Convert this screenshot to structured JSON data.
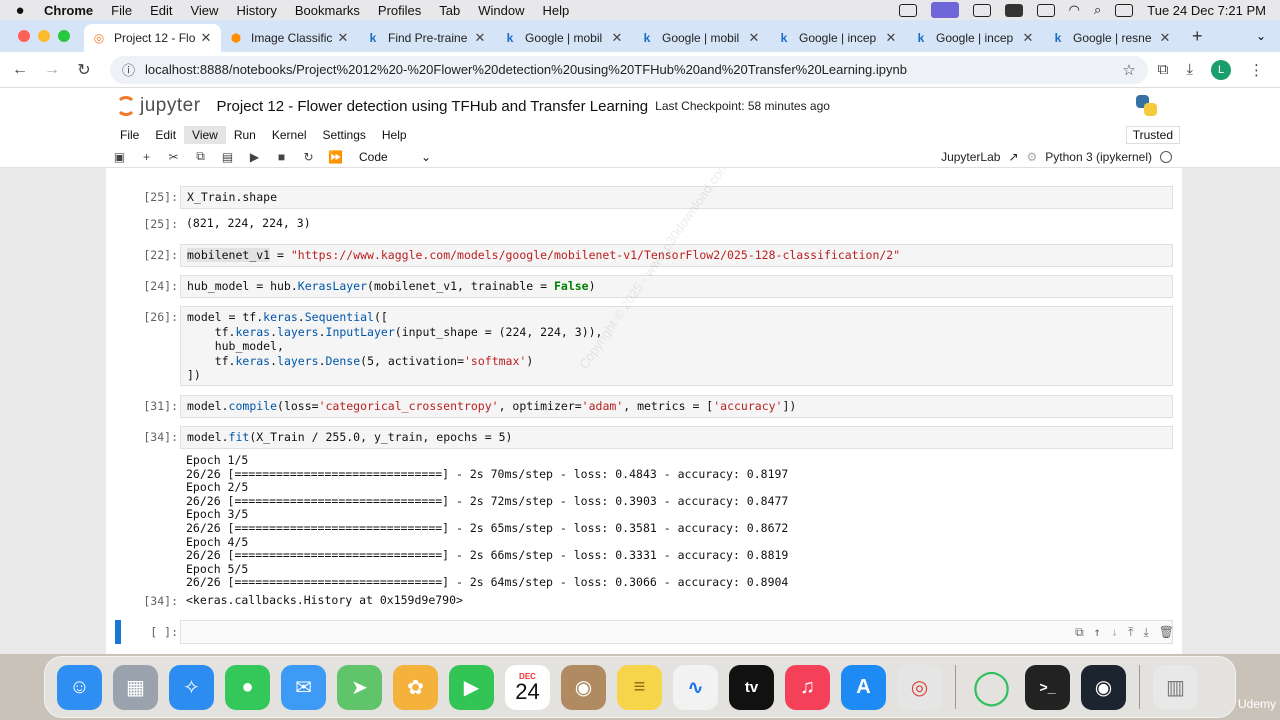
{
  "menubar": {
    "app": "Chrome",
    "items": [
      "File",
      "Edit",
      "View",
      "History",
      "Bookmarks",
      "Profiles",
      "Tab",
      "Window",
      "Help"
    ],
    "clock": "Tue 24 Dec  7:21 PM"
  },
  "tabs": [
    {
      "title": "Project 12 - Flo",
      "favicon": "jupyter-icon",
      "active": true
    },
    {
      "title": "Image Classific",
      "favicon": "tfhub-icon",
      "active": false
    },
    {
      "title": "Find Pre-traine",
      "favicon": "kaggle-icon",
      "active": false
    },
    {
      "title": "Google | mobil",
      "favicon": "kaggle-icon",
      "active": false
    },
    {
      "title": "Google | mobil",
      "favicon": "kaggle-icon",
      "active": false
    },
    {
      "title": "Google | incep",
      "favicon": "kaggle-icon",
      "active": false
    },
    {
      "title": "Google | incep",
      "favicon": "kaggle-icon",
      "active": false
    },
    {
      "title": "Google | resne",
      "favicon": "kaggle-icon",
      "active": false
    }
  ],
  "address": {
    "url": "localhost:8888/notebooks/Project%2012%20-%20Flower%20detection%20using%20TFHub%20and%20Transfer%20Learning.ipynb",
    "profile_initial": "L"
  },
  "jupyter": {
    "logo_text": "jupyter",
    "notebook_title": "Project 12 - Flower detection using TFHub and Transfer Learning",
    "checkpoint": "Last Checkpoint: 58 minutes ago",
    "menus": [
      "File",
      "Edit",
      "View",
      "Run",
      "Kernel",
      "Settings",
      "Help"
    ],
    "trusted": "Trusted",
    "cell_type": "Code",
    "jupyterlab_link": "JupyterLab",
    "kernel": "Python 3 (ipykernel)"
  },
  "cells": {
    "c1": {
      "prompt": "[25]:",
      "code": "X_Train.shape",
      "out_prompt": "[25]:",
      "output": "(821, 224, 224, 3)"
    },
    "c2": {
      "prompt": "[22]:"
    },
    "c3": {
      "prompt": "[24]:"
    },
    "c4": {
      "prompt": "[26]:"
    },
    "c5": {
      "prompt": "[31]:"
    },
    "c6": {
      "prompt": "[34]:",
      "out_prompt": "[34]:",
      "result": "<keras.callbacks.History at 0x159d9e790>"
    },
    "c7": {
      "prompt": "[ ]:"
    }
  },
  "training_log": [
    "Epoch 1/5",
    "26/26 [==============================] - 2s 70ms/step - loss: 0.4843 - accuracy: 0.8197",
    "Epoch 2/5",
    "26/26 [==============================] - 2s 72ms/step - loss: 0.3903 - accuracy: 0.8477",
    "Epoch 3/5",
    "26/26 [==============================] - 2s 65ms/step - loss: 0.3581 - accuracy: 0.8672",
    "Epoch 4/5",
    "26/26 [==============================] - 2s 66ms/step - loss: 0.3331 - accuracy: 0.8819",
    "Epoch 5/5",
    "26/26 [==============================] - 2s 64ms/step - loss: 0.3066 - accuracy: 0.8904"
  ],
  "dock": {
    "apps": [
      {
        "name": "finder-icon",
        "color": "#2f8ef1",
        "glyph": "☺"
      },
      {
        "name": "launchpad-icon",
        "color": "#9aa3ad",
        "glyph": "▦"
      },
      {
        "name": "safari-icon",
        "color": "#2d8cf0",
        "glyph": "✧"
      },
      {
        "name": "messages-icon",
        "color": "#34c759",
        "glyph": "●"
      },
      {
        "name": "mail-icon",
        "color": "#3d9bf5",
        "glyph": "✉"
      },
      {
        "name": "maps-icon",
        "color": "#5fc46a",
        "glyph": "➤"
      },
      {
        "name": "photos-icon",
        "color": "#f4b13c",
        "glyph": "✿"
      },
      {
        "name": "facetime-icon",
        "color": "#32c454",
        "glyph": "▶"
      },
      {
        "name": "calendar-icon",
        "color": "#ffffff",
        "glyph": ""
      },
      {
        "name": "contacts-icon",
        "color": "#b08b62",
        "glyph": "◉"
      },
      {
        "name": "notes-icon",
        "color": "#f7d54a",
        "glyph": "≡"
      },
      {
        "name": "freeform-icon",
        "color": "#f2f2f2",
        "glyph": "∿"
      },
      {
        "name": "appletv-icon",
        "color": "#111111",
        "glyph": "tv"
      },
      {
        "name": "music-icon",
        "color": "#f5405a",
        "glyph": "♫"
      },
      {
        "name": "appstore-icon",
        "color": "#1e8af3",
        "glyph": "A"
      },
      {
        "name": "chrome-icon",
        "color": "#e5e5e5",
        "glyph": "◎"
      },
      {
        "name": "pycharm-icon",
        "color": "#2fbf5d",
        "glyph": "◯"
      },
      {
        "name": "terminal-icon",
        "color": "#222222",
        "glyph": ">_"
      },
      {
        "name": "obs-icon",
        "color": "#1c2430",
        "glyph": "◉"
      },
      {
        "name": "trash-icon",
        "color": "#e8e8e8",
        "glyph": "🗑"
      }
    ],
    "calendar_month": "DEC",
    "calendar_day": "24"
  },
  "watermark": "Copyright © 2025 - www.p30download.com",
  "corner_label": "Udemy"
}
